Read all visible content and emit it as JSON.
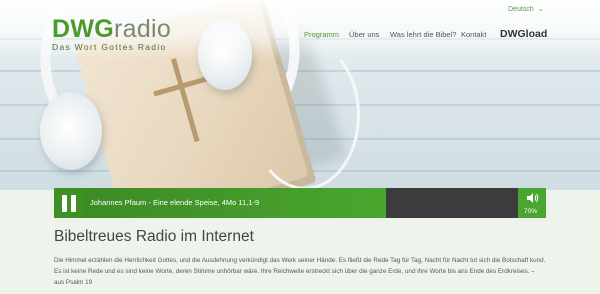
{
  "header": {
    "logo": {
      "part1": "DWG",
      "part2": "radio",
      "tagline": "Das Wort Gottes Radio"
    },
    "language": "Deutsch",
    "nav": {
      "programm": "Programm",
      "ueber_uns": "Über uns",
      "bibel": "Was lehrt die Bibel?",
      "kontakt": "Kontakt",
      "dwgload": "DWGload"
    }
  },
  "player": {
    "track_title": "Johannes Pfaum - Eine elende Speise, 4Mo 11,1-9",
    "volume": "70%"
  },
  "main": {
    "heading": "Bibeltreues Radio im Internet",
    "paragraph": "Die Himmel erzählen die Herrlichkeit Gottes, und die Ausdehnung verkündigt das Werk seiner Hände. Es fließt die Rede Tag für Tag, Nacht für Nacht tut sich die Botschaft kund. Es ist keine Rede und es sind keine Worte, deren Stimme unhörbar wäre. Ihre Reichweite erstreckt sich über die ganze Erde, und ihre Worte bis ans Ende des Erdkreises. – aus Psalm 19"
  },
  "colors": {
    "brand_green": "#4aa62f",
    "player_dark": "#3c3c3c",
    "nav_active": "#4c9a2a"
  }
}
